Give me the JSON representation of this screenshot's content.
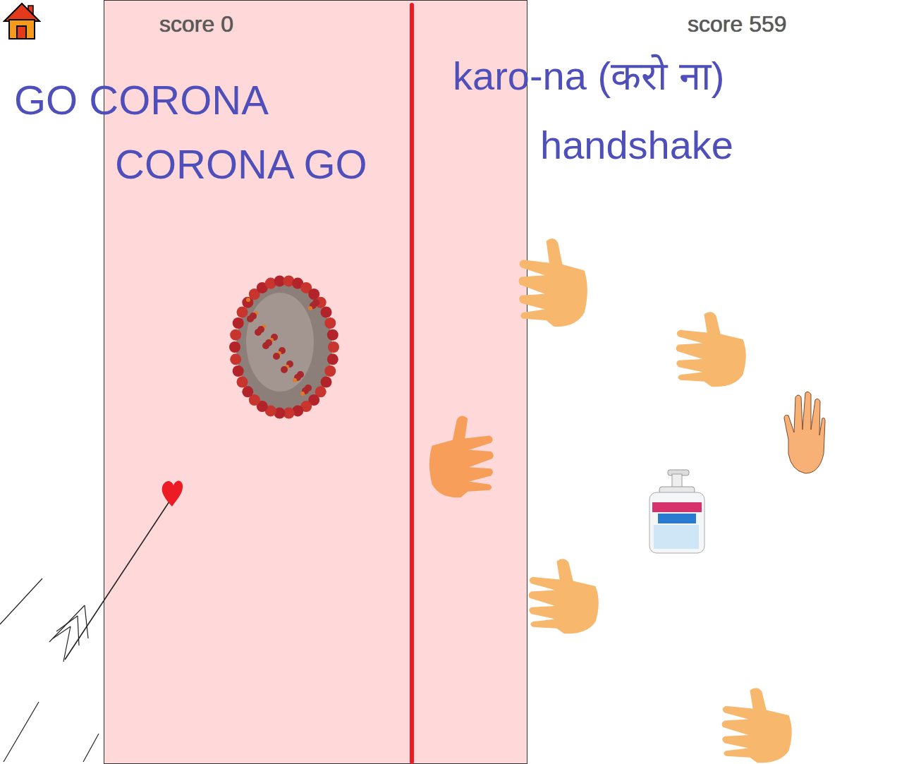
{
  "scores": {
    "left": "score 0",
    "right": "score 559"
  },
  "slogans": [
    "GO CORONA",
    "CORONA GO"
  ],
  "captions": [
    "karo-na (करो ना)",
    "handshake"
  ]
}
